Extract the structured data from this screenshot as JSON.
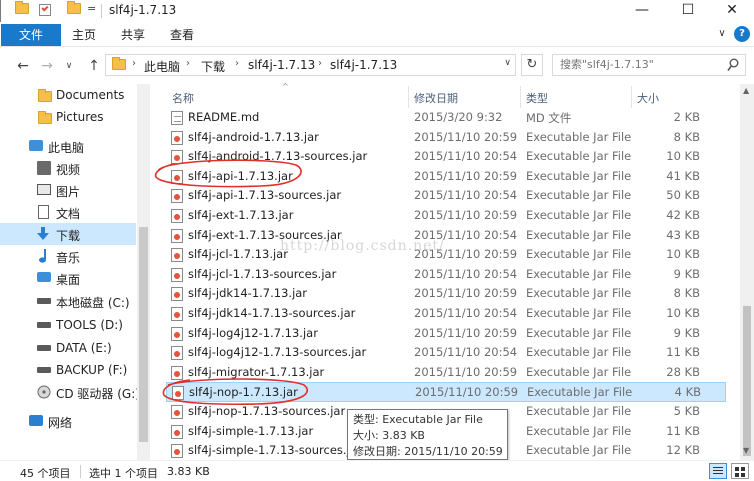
{
  "window": {
    "title": "slf4j-1.7.13",
    "quick_access_dropdown": "=",
    "minimize_glyph": "—",
    "maximize_glyph": "☐",
    "close_glyph": "✕"
  },
  "ribbon": {
    "file_tab": "文件",
    "tabs": [
      "主页",
      "共享",
      "查看"
    ],
    "collapse_glyph": "∨",
    "help_glyph": "?"
  },
  "navigation": {
    "back_glyph": "←",
    "forward_glyph": "→",
    "recent_glyph": "∨",
    "up_glyph": "↑",
    "breadcrumbs": [
      "此电脑",
      "下载",
      "slf4j-1.7.13",
      "slf4j-1.7.13"
    ],
    "crumb_separator": "›",
    "address_dropdown": "∨",
    "refresh_glyph": "↻",
    "search_placeholder": "搜索\"slf4j-1.7.13\""
  },
  "nav_pane": {
    "items": [
      {
        "label": "Documents",
        "icon": "folder-icon"
      },
      {
        "label": "Pictures",
        "icon": "folder-icon"
      },
      {
        "label": "此电脑",
        "icon": "computer-icon"
      },
      {
        "label": "视频",
        "icon": "video-icon"
      },
      {
        "label": "图片",
        "icon": "picture-icon"
      },
      {
        "label": "文档",
        "icon": "document-icon"
      },
      {
        "label": "下载",
        "icon": "download-icon"
      },
      {
        "label": "音乐",
        "icon": "music-icon"
      },
      {
        "label": "桌面",
        "icon": "desktop-icon"
      },
      {
        "label": "本地磁盘 (C:)",
        "icon": "drive-icon"
      },
      {
        "label": "TOOLS (D:)",
        "icon": "drive-icon"
      },
      {
        "label": "DATA (E:)",
        "icon": "drive-icon"
      },
      {
        "label": "BACKUP (F:)",
        "icon": "drive-icon"
      },
      {
        "label": "CD 驱动器 (G:)",
        "icon": "cd-drive-icon"
      },
      {
        "label": "网络",
        "icon": "network-icon"
      }
    ],
    "selected_label": "下载"
  },
  "file_list": {
    "columns": [
      "名称",
      "修改日期",
      "类型",
      "大小"
    ],
    "sort_glyph": "^",
    "rows": [
      {
        "name": "README.md",
        "date": "2015/3/20 9:32",
        "type": "MD 文件",
        "size": "2 KB"
      },
      {
        "name": "slf4j-android-1.7.13.jar",
        "date": "2015/11/10 20:59",
        "type": "Executable Jar File",
        "size": "8 KB"
      },
      {
        "name": "slf4j-android-1.7.13-sources.jar",
        "date": "2015/11/10 20:54",
        "type": "Executable Jar File",
        "size": "10 KB"
      },
      {
        "name": "slf4j-api-1.7.13.jar",
        "date": "2015/11/10 20:59",
        "type": "Executable Jar File",
        "size": "41 KB"
      },
      {
        "name": "slf4j-api-1.7.13-sources.jar",
        "date": "2015/11/10 20:54",
        "type": "Executable Jar File",
        "size": "50 KB"
      },
      {
        "name": "slf4j-ext-1.7.13.jar",
        "date": "2015/11/10 20:59",
        "type": "Executable Jar File",
        "size": "42 KB"
      },
      {
        "name": "slf4j-ext-1.7.13-sources.jar",
        "date": "2015/11/10 20:54",
        "type": "Executable Jar File",
        "size": "43 KB"
      },
      {
        "name": "slf4j-jcl-1.7.13.jar",
        "date": "2015/11/10 20:59",
        "type": "Executable Jar File",
        "size": "10 KB"
      },
      {
        "name": "slf4j-jcl-1.7.13-sources.jar",
        "date": "2015/11/10 20:54",
        "type": "Executable Jar File",
        "size": "9 KB"
      },
      {
        "name": "slf4j-jdk14-1.7.13.jar",
        "date": "2015/11/10 20:59",
        "type": "Executable Jar File",
        "size": "8 KB"
      },
      {
        "name": "slf4j-jdk14-1.7.13-sources.jar",
        "date": "2015/11/10 20:54",
        "type": "Executable Jar File",
        "size": "10 KB"
      },
      {
        "name": "slf4j-log4j12-1.7.13.jar",
        "date": "2015/11/10 20:59",
        "type": "Executable Jar File",
        "size": "9 KB"
      },
      {
        "name": "slf4j-log4j12-1.7.13-sources.jar",
        "date": "2015/11/10 20:54",
        "type": "Executable Jar File",
        "size": "11 KB"
      },
      {
        "name": "slf4j-migrator-1.7.13.jar",
        "date": "2015/11/10 20:59",
        "type": "Executable Jar File",
        "size": "28 KB"
      },
      {
        "name": "slf4j-nop-1.7.13.jar",
        "date": "2015/11/10 20:59",
        "type": "Executable Jar File",
        "size": "4 KB"
      },
      {
        "name": "slf4j-nop-1.7.13-sources.jar",
        "date": "",
        "type": "Executable Jar File",
        "size": "5 KB"
      },
      {
        "name": "slf4j-simple-1.7.13.jar",
        "date": "",
        "type": "Executable Jar File",
        "size": "11 KB"
      },
      {
        "name": "slf4j-simple-1.7.13-sources.jar",
        "date": "",
        "type": "Executable Jar File",
        "size": "12 KB"
      }
    ],
    "selected_name": "slf4j-nop-1.7.13.jar"
  },
  "tooltip": {
    "type_line": "类型: Executable Jar File",
    "size_line": "大小: 3.83 KB",
    "date_line": "修改日期: 2015/11/10 20:59"
  },
  "status_bar": {
    "item_count": "45 个项目",
    "selection": "选中 1 个项目",
    "selection_size": "3.83 KB"
  },
  "watermark": "http://blog.csdn.net/",
  "colors": {
    "accent": "#1979ca",
    "selection": "#cce8ff",
    "annotation": "#e0302a"
  }
}
